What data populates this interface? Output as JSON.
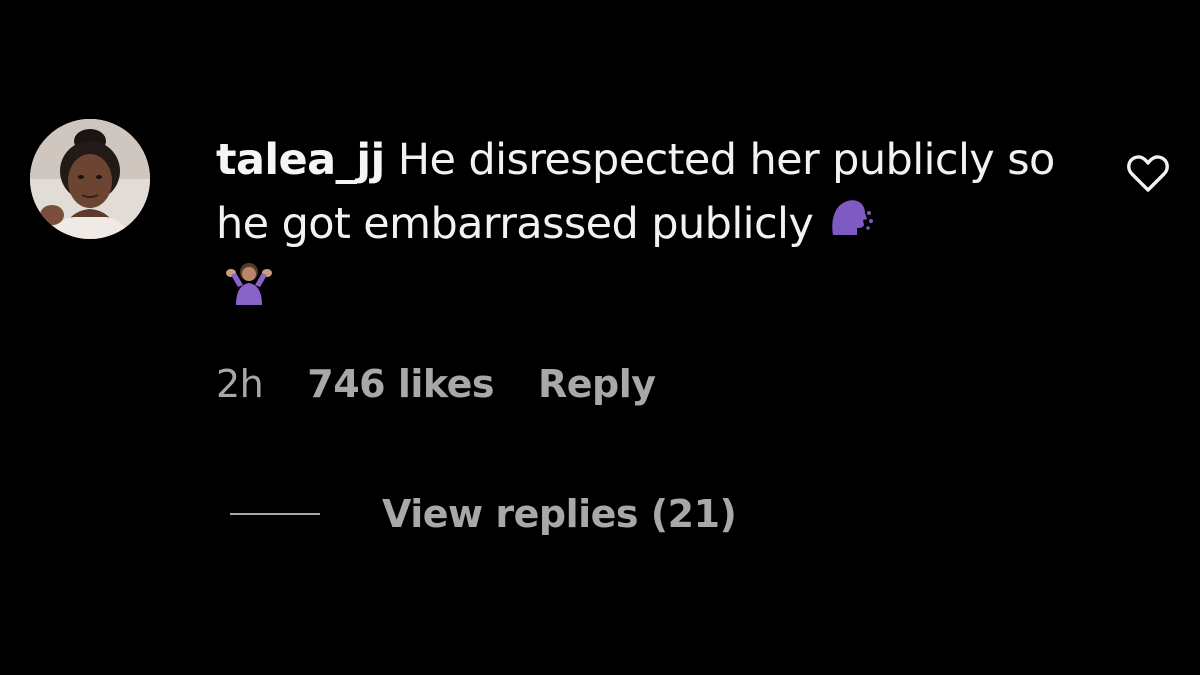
{
  "comment": {
    "username": "talea_jj",
    "text": "He disrespected her publicly so he got embarrassed publicly",
    "emojis": [
      "speaking-head-emoji",
      "person-shrugging-emoji"
    ],
    "time": "2h",
    "likes": "746 likes",
    "reply_label": "Reply",
    "view_replies_label": "View replies (21)",
    "like_icon": "heart-outline-icon"
  },
  "colors": {
    "background": "#000000",
    "primary_text": "#f5f5f5",
    "secondary_text": "#a8a8a8",
    "emoji_purple": "#7e5bc2"
  }
}
